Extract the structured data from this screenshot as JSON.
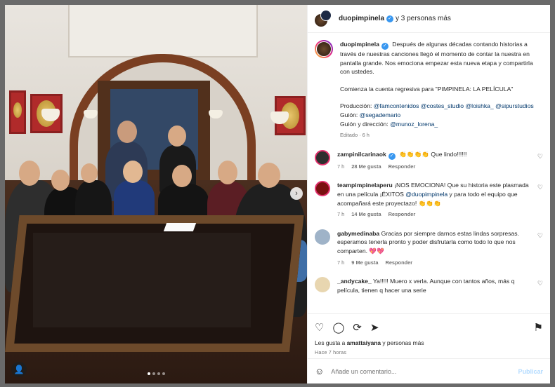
{
  "header": {
    "username": "duopimpinela",
    "others": "y 3 personas más"
  },
  "caption": {
    "username": "duopimpinela",
    "line1": "Después de algunas décadas contando historias a través de nuestras canciones llegó el momento de contar la nuestra en pantalla grande. Nos emociona empezar esta nueva etapa y compartirla con ustedes.",
    "line2": "Comienza la cuenta regresiva para \"PIMPINELA: LA PELÍCULA\"",
    "prod_label": "Producción:",
    "prod_tags": "@famcontenidos @costes_studio @loishka_ @sipurstudios",
    "guion_label": "Guión:",
    "guion_tag": "@segademario",
    "gd_label": "Guión y dirección:",
    "gd_tag": "@munoz_lorena_",
    "edited": "Editado · 6 h"
  },
  "comments": [
    {
      "user": "zampinilcarinaok",
      "text_pre": "👏👏👏👏 Que lindo!!!!!!",
      "mention": "",
      "text_post": "",
      "time": "7 h",
      "likes": "28 Me gusta",
      "reply": "Responder",
      "avatar_color": "#2f2f2f"
    },
    {
      "user": "teampimpinelaperu",
      "text_pre": "¡NOS EMOCIONA! Que su historia este plasmada en una película ¡ÉXITOS ",
      "mention": "@duopimpinela",
      "text_post": " y para todo el equipo que acompañará este proyectazo! 👏👏👏",
      "time": "7 h",
      "likes": "14 Me gusta",
      "reply": "Responder",
      "avatar_color": "#7a1010"
    },
    {
      "user": "gabymedinaba",
      "text_pre": "Gracias por siempre darnos estas lindas sorpresas. esperamos tenerla pronto y poder disfrutarla como todo lo que nos comparten. 💖💖",
      "mention": "",
      "text_post": "",
      "time": "7 h",
      "likes": "9 Me gusta",
      "reply": "Responder",
      "avatar_color": "#9fb3c8"
    },
    {
      "user": "_andycake_",
      "text_pre": "Ya!!!!! Muero x verla. Aunque con tantos años, más q película, tienen q hacer una serie",
      "mention": "",
      "text_post": "",
      "time": "",
      "likes": "",
      "reply": "",
      "avatar_color": "#e8d6b0"
    }
  ],
  "likes_line": {
    "prefix": "Les gusta a",
    "user": "amattaiyana",
    "suffix": "y personas más"
  },
  "posted": "Hace 7 horas",
  "add_comment": {
    "placeholder": "Añade un comentario...",
    "publish": "Publicar"
  },
  "icons": {
    "like": "heart-icon",
    "comment": "comment-icon",
    "share": "share-icon",
    "send": "send-icon",
    "save": "bookmark-icon",
    "emoji": "emoji-icon",
    "next": "chevron-right-icon",
    "tag": "user-tag-icon"
  },
  "carousel": {
    "count": 4,
    "active": 1
  },
  "colors": {
    "link": "#00376b",
    "verified": "#3897f0",
    "publish": "#b3dbff"
  }
}
